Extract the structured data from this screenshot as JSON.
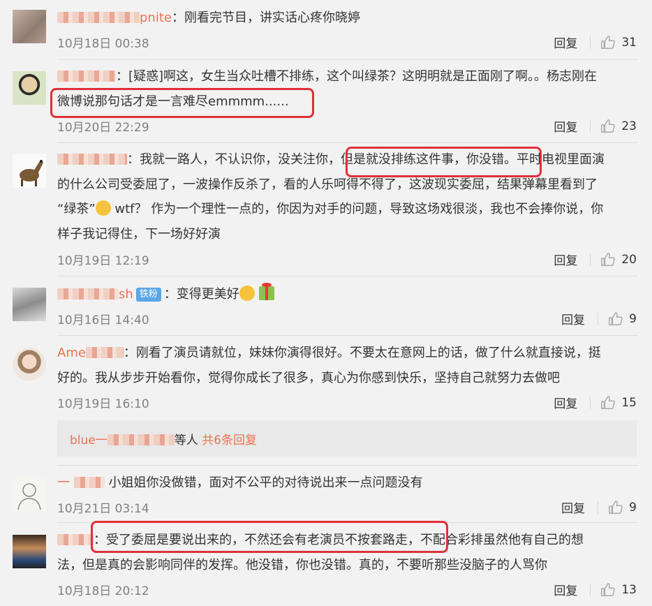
{
  "icon_color": "#b0b0b0",
  "comments": [
    {
      "user": "pnite",
      "text": "：刚看完节目，讲实话心疼你晓婷",
      "time": "10月18日 00:38",
      "reply": "回复",
      "likes": "31"
    },
    {
      "user": "",
      "text": "[疑惑]啊这，女生当众吐槽不排练，这个叫绿茶？这明明就是正面刚了啊。。杨志刚在",
      "text2": "微博说那句话才是一言难尽emmmm......",
      "time": "10月20日 22:29",
      "reply": "回复",
      "likes": "23"
    },
    {
      "user": "",
      "text_a": "：我就一路人，不认识你，没关注你，",
      "text_b": "但是就没排练这件事，你没错。",
      "text_c": "平时电视里面演",
      "line2": "的什么公司受委屈了，一波操作反杀了，看的人乐呵得不得了，这波现实委屈，结果弹幕里看到了",
      "line3_a": "“绿茶”",
      "line3_b": " wtf？ 作为一个理性一点的，你因为对手的问题，导致这场戏很淡，我也不会捧你说，你",
      "line4": "样子我记得住，下一场好好演",
      "time": "10月19日 12:19",
      "reply": "回复",
      "likes": "20"
    },
    {
      "user": "sh",
      "badge": "铁粉",
      "text": "：变得更美好",
      "time": "10月16日 14:40",
      "reply": "回复",
      "likes": "9"
    },
    {
      "user": "Ame",
      "text": "：刚看了演员请就位，妹妹你演得很好。不要太在意网上的话，做了什么就直接说，挺",
      "text2": "好的。我从步步开始看你，觉得你成长了很多，真心为你感到快乐，坚持自己就努力去做吧",
      "time": "10月19日 16:10",
      "reply": "回复",
      "likes": "15",
      "replies_user": "blue一",
      "replies_mid": "等人",
      "replies_count": "共6条回复"
    },
    {
      "user": "一",
      "text": "小姐姐你没做错，面对不公平的对待说出来一点问题没有",
      "time": "10月21日 03:14",
      "reply": "回复",
      "likes": "9"
    },
    {
      "user": "",
      "text_a": "：受了委屈是要说出来的，不然还会有老演员不按套路走，",
      "text_b": "不配合彩排虽然他有自己的想",
      "text2": "法，但是真的会影响同伴的发挥。他没错，你也没错。真的，不要听那些没脑子的人骂你",
      "time": "10月18日 20:12",
      "reply": "回复",
      "likes": "13"
    }
  ]
}
